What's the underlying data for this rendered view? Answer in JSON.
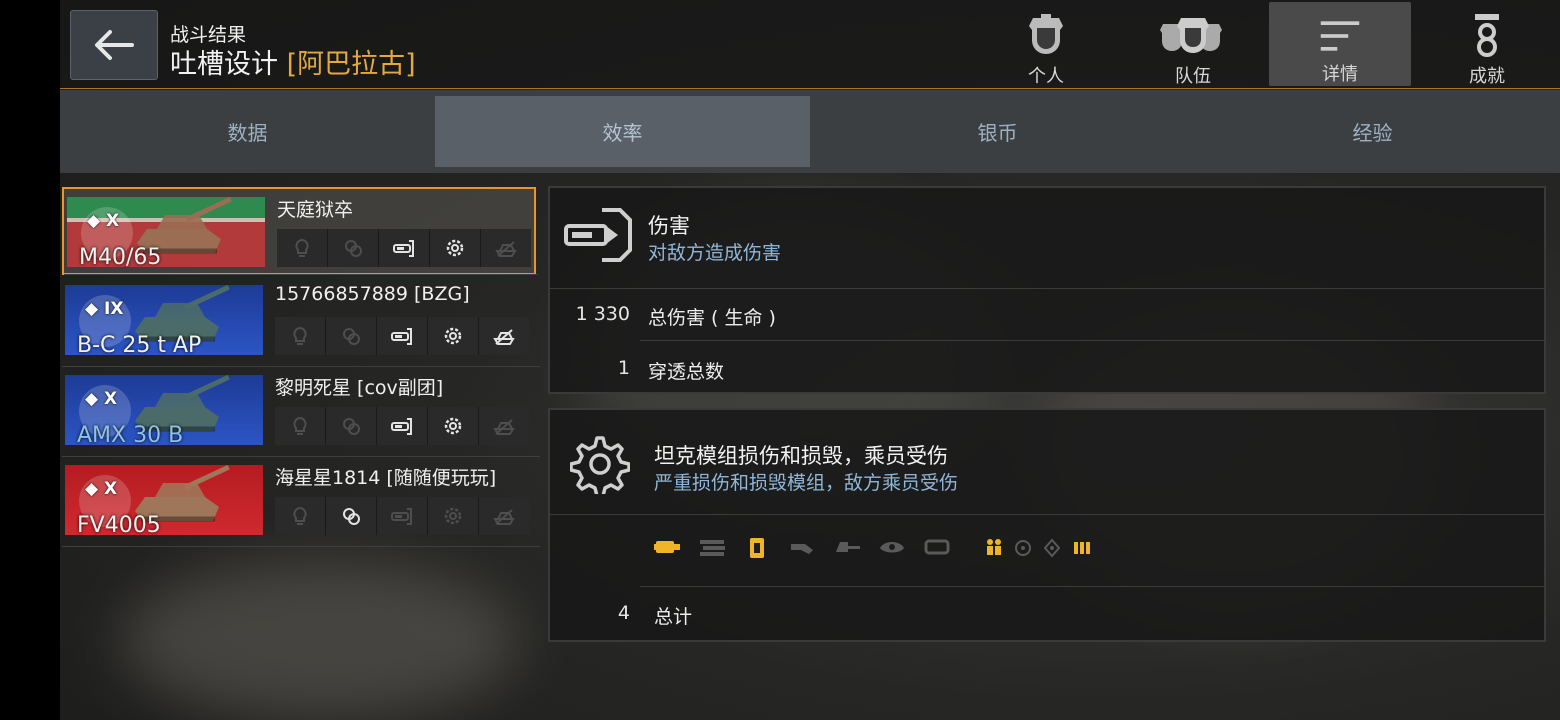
{
  "header": {
    "subtitle": "战斗结果",
    "player_name": "吐槽设计",
    "clan_tag": "[阿巴拉古]",
    "nav": [
      {
        "label": "个人",
        "icon": "personal-icon",
        "active": false
      },
      {
        "label": "队伍",
        "icon": "team-icon",
        "active": false
      },
      {
        "label": "详情",
        "icon": "details-icon",
        "active": true
      },
      {
        "label": "成就",
        "icon": "achievements-icon",
        "active": false
      }
    ]
  },
  "tabs": [
    {
      "label": "数据",
      "active": false
    },
    {
      "label": "效率",
      "active": true
    },
    {
      "label": "银币",
      "active": false
    },
    {
      "label": "经验",
      "active": false
    }
  ],
  "players": [
    {
      "name": "天庭狱卒",
      "tank": "M40/65",
      "tier": "X",
      "flag": "usa",
      "selected": true,
      "badges": [
        "spotting-icon",
        "assist-icon",
        "damage-icon",
        "module-icon",
        "kill-icon"
      ],
      "badges_active": [
        false,
        false,
        true,
        true,
        false
      ]
    },
    {
      "name": "15766857889 [BZG]",
      "tank": "B-C 25 t AP",
      "tier": "IX",
      "flag": "france",
      "selected": false,
      "badges": [
        "spotting-icon",
        "assist-icon",
        "damage-icon",
        "module-icon",
        "kill-icon"
      ],
      "badges_active": [
        false,
        false,
        true,
        true,
        true
      ]
    },
    {
      "name": "黎明死星 [cov副团]",
      "tank": "AMX 30 B",
      "tier": "X",
      "flag": "france",
      "selected": false,
      "tank_blue": true,
      "badges": [
        "spotting-icon",
        "assist-icon",
        "damage-icon",
        "module-icon",
        "kill-icon"
      ],
      "badges_active": [
        false,
        false,
        true,
        true,
        false
      ]
    },
    {
      "name": "海星星1814 [随随便玩玩]",
      "tank": "FV4005",
      "tier": "X",
      "flag": "uk",
      "selected": false,
      "badges": [
        "spotting-icon",
        "assist-icon",
        "damage-icon",
        "module-icon",
        "kill-icon"
      ],
      "badges_active": [
        false,
        true,
        false,
        false,
        false
      ]
    }
  ],
  "damage_card": {
    "title": "伤害",
    "desc": "对敌方造成伤害",
    "rows": [
      {
        "value": "1 330",
        "label": "总伤害 ( 生命 )"
      },
      {
        "value": "1",
        "label": "穿透总数"
      }
    ]
  },
  "module_card": {
    "title": "坦克模组损伤和损毁，乘员受伤",
    "desc": "严重损伤和损毁模组，敌方乘员受伤",
    "modules": [
      "engine-icon",
      "ammo-rack-icon",
      "fuel-tank-icon",
      "gun-icon",
      "turret-icon",
      "optics-icon",
      "track-icon"
    ],
    "modules_hit": [
      true,
      false,
      true,
      false,
      false,
      false,
      false
    ],
    "crew": [
      "commander-icon",
      "gunner-icon",
      "driver-icon",
      "loader-icon"
    ],
    "crew_hit": [
      true,
      false,
      false,
      true
    ],
    "total_value": "4",
    "total_label": "总计"
  },
  "colors": {
    "accent": "#e8952e",
    "hit": "#f0b428",
    "muted": "#5a5a5a",
    "desc": "#8fb6d8"
  }
}
